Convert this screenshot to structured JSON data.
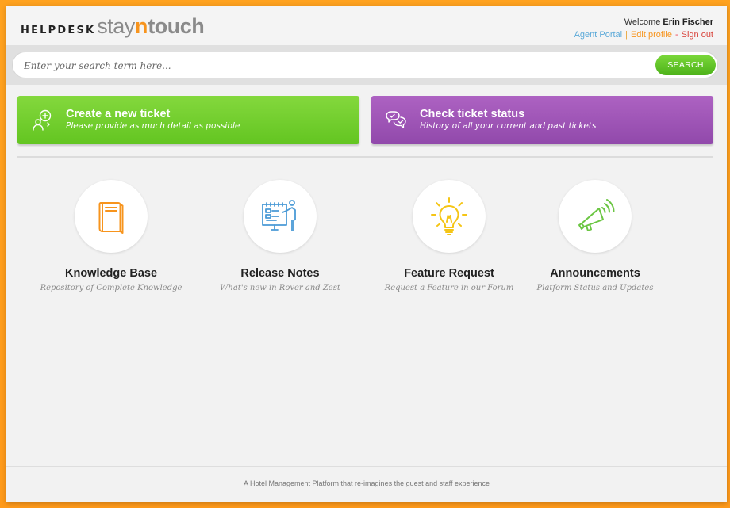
{
  "header": {
    "logo_helpdesk": "HELPDESK",
    "logo_stay": "stay",
    "logo_n": "n",
    "logo_touch": "touch",
    "welcome_prefix": "Welcome",
    "user_name": "Erin Fischer",
    "links": {
      "agent_portal": "Agent Portal",
      "sep1": "|",
      "edit_profile": "Edit profile",
      "sep2": "-",
      "sign_out": "Sign out"
    }
  },
  "search": {
    "placeholder": "Enter your search term here...",
    "button_label": "SEARCH"
  },
  "actions": {
    "create": {
      "title": "Create a new ticket",
      "subtitle": "Please provide as much detail as possible",
      "icon": "add-ticket-chat-icon",
      "color": "#6ccb28"
    },
    "status": {
      "title": "Check ticket status",
      "subtitle": "History of all your current and past tickets",
      "icon": "chat-check-icon",
      "color": "#9c52b5"
    }
  },
  "tiles": [
    {
      "title": "Knowledge Base",
      "subtitle": "Repository of Complete Knowledge",
      "icon": "book-icon",
      "color": "#f7941d"
    },
    {
      "title": "Release Notes",
      "subtitle": "What's new in Rover and Zest",
      "icon": "presentation-board-icon",
      "color": "#4a9ad6"
    },
    {
      "title": "Feature Request",
      "subtitle": "Request a Feature in our Forum",
      "icon": "lightbulb-icon",
      "color": "#f5c515"
    },
    {
      "title": "Announcements",
      "subtitle": "Platform Status and Updates",
      "icon": "megaphone-icon",
      "color": "#6cc644"
    }
  ],
  "footer": {
    "text": "A Hotel Management Platform that re-imagines the guest and staff experience"
  }
}
